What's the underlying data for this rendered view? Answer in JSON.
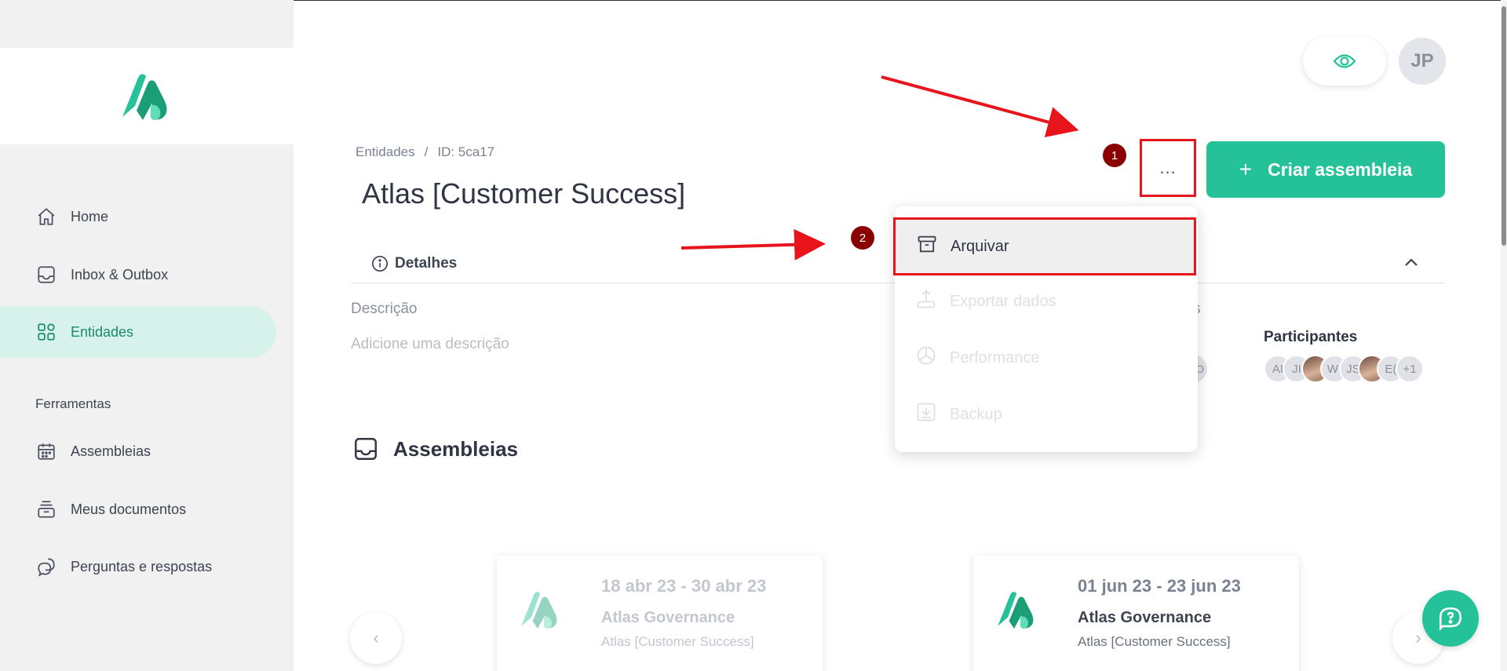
{
  "sidebar": {
    "items": [
      {
        "label": "Home",
        "icon": "home-icon"
      },
      {
        "label": "Inbox & Outbox",
        "icon": "inbox-icon"
      },
      {
        "label": "Entidades",
        "icon": "grid-icon",
        "active": true
      }
    ],
    "tools_label": "Ferramentas",
    "tools": [
      {
        "label": "Assembleias",
        "icon": "calendar-icon"
      },
      {
        "label": "Meus documentos",
        "icon": "documents-icon"
      },
      {
        "label": "Perguntas e respostas",
        "icon": "chat-icon"
      }
    ]
  },
  "header": {
    "user_initials": "JP",
    "breadcrumb": [
      "Entidades",
      "/",
      "ID: 5ca17"
    ],
    "title": "Atlas [Customer Success]",
    "more_label": "...",
    "create_label": "Criar assembleia",
    "create_plus": "+"
  },
  "details": {
    "tab_label": "Detalhes",
    "description_label": "Descrição",
    "description_placeholder": "Adicione uma descrição",
    "members_partial": "s",
    "participants_label": "Participantes",
    "partial_avatar": "O",
    "participants": [
      "AI",
      "JI",
      "",
      "WI",
      "JS",
      "",
      "E(",
      "+1"
    ]
  },
  "dropdown": {
    "items": [
      {
        "label": "Arquivar",
        "icon": "archive-icon",
        "enabled": true
      },
      {
        "label": "Exportar dados",
        "icon": "export-icon",
        "enabled": false
      },
      {
        "label": "Performance",
        "icon": "chart-pie-icon",
        "enabled": false
      },
      {
        "label": "Backup",
        "icon": "download-icon",
        "enabled": false
      }
    ]
  },
  "assembleias": {
    "title": "Assembleias",
    "cards": [
      {
        "date": "18 abr 23 - 30 abr 23",
        "name": "Atlas Governance",
        "entity": "Atlas [Customer Success]",
        "faded": true
      },
      {
        "date": "01 jun 23 - 23 jun 23",
        "name": "Atlas Governance",
        "entity": "Atlas [Customer Success]",
        "faded": false
      }
    ],
    "prev": "‹",
    "next": "›"
  },
  "annotations": {
    "step1": "1",
    "step2": "2",
    "color": "#e8141c",
    "badge_color": "#8b0000"
  },
  "colors": {
    "accent": "#25c29a",
    "active_bg": "#d6f2ea",
    "active_text": "#1a8b6d"
  }
}
